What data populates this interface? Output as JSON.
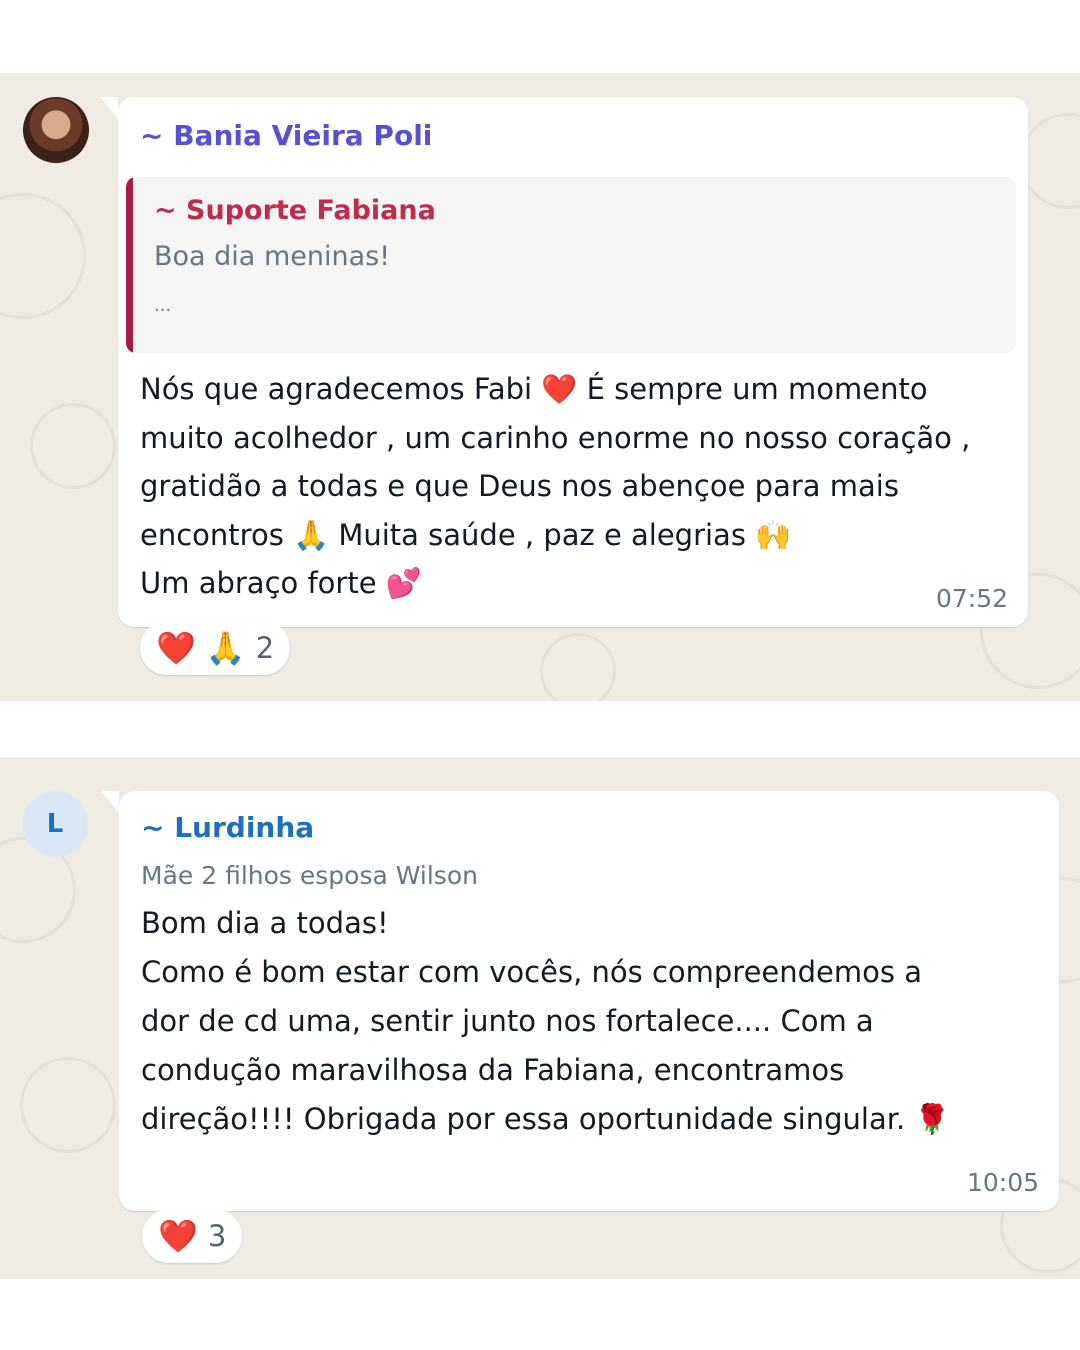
{
  "messages": [
    {
      "sender": "~ Bania Vieira Poli",
      "quote": {
        "author": "~ Suporte Fabiana",
        "text": "Boa dia meninas!",
        "ellipsis": "..."
      },
      "lines": [
        "Nós que agradecemos Fabi ❤️ É sempre um momento",
        "muito acolhedor , um carinho enorme no nosso coração ,",
        "gratidão a todas e que Deus nos abençoe para mais",
        "encontros 🙏  Muita saúde , paz e alegrias 🙌",
        "Um abraço forte 💕"
      ],
      "time": "07:52",
      "reactions": {
        "emojis": [
          "❤️",
          "🙏"
        ],
        "count": "2"
      }
    },
    {
      "avatar_letter": "L",
      "sender": "~ Lurdinha",
      "status": "Mãe 2 filhos esposa Wilson",
      "lines": [
        "Bom dia a todas!",
        "Como é bom estar com vocês, nós compreendemos a",
        "dor de cd uma, sentir junto nos fortalece.... Com a",
        "condução maravilhosa da Fabiana, encontramos",
        "direção!!!! Obrigada por essa oportunidade singular. 🌹"
      ],
      "time": "10:05",
      "reactions": {
        "emojis": [
          "❤️"
        ],
        "count": "3"
      }
    }
  ],
  "colors": {
    "chat_background": "#efeae2",
    "bubble": "#ffffff",
    "sender_1": "#5b4fd1",
    "sender_2": "#1f6fbf",
    "quote_bar": "#a31c45",
    "quote_author": "#c02a4c"
  }
}
